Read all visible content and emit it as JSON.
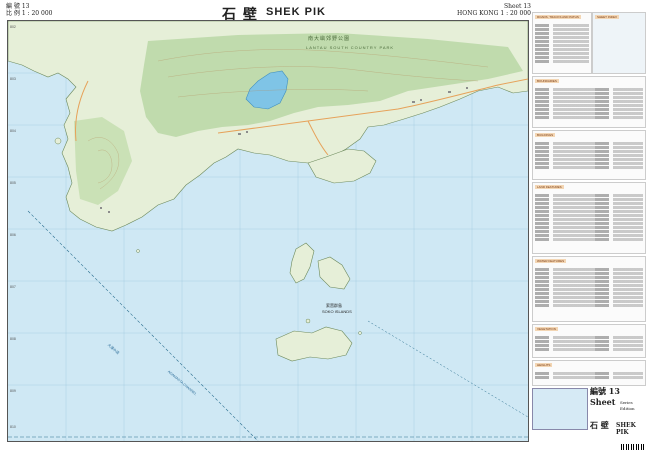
{
  "header": {
    "left_line1": "編 號 13",
    "left_line2": "比 例 1 : 20 000",
    "title_cn": "石 壁",
    "title_en": "SHEK  PIK",
    "right_line1": "Sheet 13",
    "right_line2": "HONG KONG 1 : 20 000"
  },
  "map": {
    "park_cn": "南大嶼郊野公園",
    "park_en": "LANTAU SOUTH COUNTRY PARK",
    "islands_cn": "索罟群島",
    "islands_en": "SOKO ISLANDS",
    "channel_cn": "大濠水道",
    "channel_en": "ADAMASTA CHANNEL",
    "grid_labels": [
      "802",
      "803",
      "804",
      "805",
      "806",
      "807",
      "808",
      "809",
      "810"
    ]
  },
  "legend": {
    "block_titles": [
      "ROADS, TRACKS AND PATHS",
      "BOUNDARIES",
      "BUILDINGS",
      "LAND FEATURES",
      "WATER FEATURES",
      "VEGETATION",
      "HEIGHTS",
      "ADMINISTRATIVE",
      "SHEET INDEX"
    ],
    "sheet_label": "編號 13 Sheet",
    "series_label": "Series",
    "edition_label": "Edition",
    "name_cn": "石 壁",
    "name_en": "SHEK PIK"
  },
  "colors": {
    "sea": "#cfe8f4",
    "land": "#e6efd8",
    "forest": "#b9d7a6",
    "reservoir": "#7fc4e6",
    "road": "#e6a25a",
    "boundary": "#2b6f8f"
  }
}
